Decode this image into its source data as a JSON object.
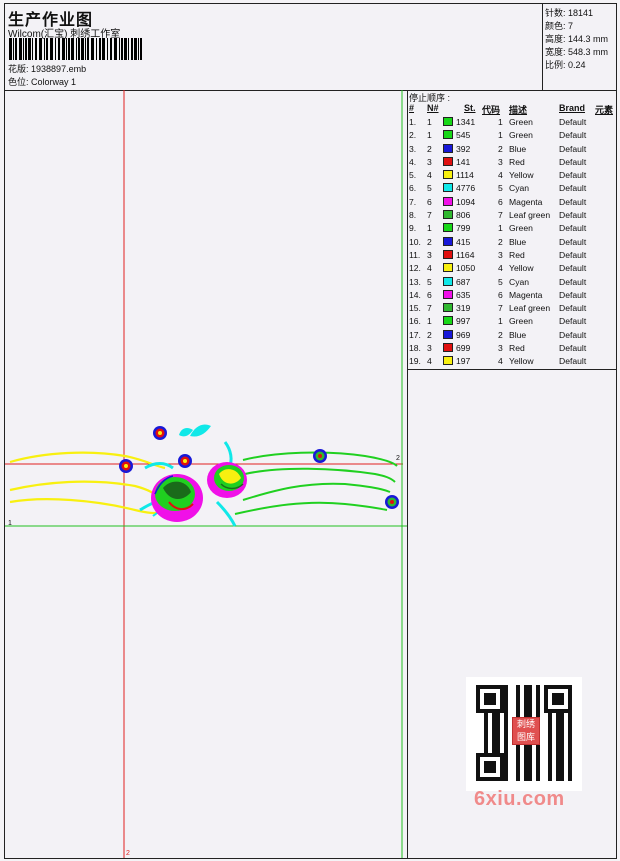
{
  "header": {
    "title": "生产作业图",
    "company": "Wilcom(汇宝) 刺绣工作室",
    "pattern_label": "花版:",
    "pattern_value": "1938897.emb",
    "colorway_label": "色位:",
    "colorway_value": "Colorway 1"
  },
  "specs": [
    {
      "label": "针数:",
      "value": "18141"
    },
    {
      "label": "颜色:",
      "value": "7"
    },
    {
      "label": "高度:",
      "value": "144.3 mm"
    },
    {
      "label": "宽度:",
      "value": "548.3 mm"
    },
    {
      "label": "比例:",
      "value": "0.24"
    }
  ],
  "stop_sequence": {
    "title": "停止顺序 :",
    "columns": [
      "#",
      "N#",
      "St.",
      "代码",
      "描述",
      "Brand",
      "元素"
    ],
    "rows": [
      {
        "idx": "1.",
        "n": "1",
        "st": "1341",
        "code": "1",
        "desc": "Green",
        "brand": "Default",
        "color": "#18d818"
      },
      {
        "idx": "2.",
        "n": "1",
        "st": "545",
        "code": "1",
        "desc": "Green",
        "brand": "Default",
        "color": "#18d818"
      },
      {
        "idx": "3.",
        "n": "2",
        "st": "392",
        "code": "2",
        "desc": "Blue",
        "brand": "Default",
        "color": "#1818d8"
      },
      {
        "idx": "4.",
        "n": "3",
        "st": "141",
        "code": "3",
        "desc": "Red",
        "brand": "Default",
        "color": "#e01010"
      },
      {
        "idx": "5.",
        "n": "4",
        "st": "1114",
        "code": "4",
        "desc": "Yellow",
        "brand": "Default",
        "color": "#f8f010"
      },
      {
        "idx": "6.",
        "n": "5",
        "st": "4776",
        "code": "5",
        "desc": "Cyan",
        "brand": "Default",
        "color": "#10e8e8"
      },
      {
        "idx": "7.",
        "n": "6",
        "st": "1094",
        "code": "6",
        "desc": "Magenta",
        "brand": "Default",
        "color": "#f010e8"
      },
      {
        "idx": "8.",
        "n": "7",
        "st": "806",
        "code": "7",
        "desc": "Leaf green",
        "brand": "Default",
        "color": "#30b830"
      },
      {
        "idx": "9.",
        "n": "1",
        "st": "799",
        "code": "1",
        "desc": "Green",
        "brand": "Default",
        "color": "#18d818"
      },
      {
        "idx": "10.",
        "n": "2",
        "st": "415",
        "code": "2",
        "desc": "Blue",
        "brand": "Default",
        "color": "#1818d8"
      },
      {
        "idx": "11.",
        "n": "3",
        "st": "1164",
        "code": "3",
        "desc": "Red",
        "brand": "Default",
        "color": "#e01010"
      },
      {
        "idx": "12.",
        "n": "4",
        "st": "1050",
        "code": "4",
        "desc": "Yellow",
        "brand": "Default",
        "color": "#f8f010"
      },
      {
        "idx": "13.",
        "n": "5",
        "st": "687",
        "code": "5",
        "desc": "Cyan",
        "brand": "Default",
        "color": "#10e8e8"
      },
      {
        "idx": "14.",
        "n": "6",
        "st": "635",
        "code": "6",
        "desc": "Magenta",
        "brand": "Default",
        "color": "#f010e8"
      },
      {
        "idx": "15.",
        "n": "7",
        "st": "319",
        "code": "7",
        "desc": "Leaf green",
        "brand": "Default",
        "color": "#30b830"
      },
      {
        "idx": "16.",
        "n": "1",
        "st": "997",
        "code": "1",
        "desc": "Green",
        "brand": "Default",
        "color": "#18d818"
      },
      {
        "idx": "17.",
        "n": "2",
        "st": "969",
        "code": "2",
        "desc": "Blue",
        "brand": "Default",
        "color": "#1818d8"
      },
      {
        "idx": "18.",
        "n": "3",
        "st": "699",
        "code": "3",
        "desc": "Red",
        "brand": "Default",
        "color": "#e01010"
      },
      {
        "idx": "19.",
        "n": "4",
        "st": "197",
        "code": "4",
        "desc": "Yellow",
        "brand": "Default",
        "color": "#f8f010"
      }
    ]
  },
  "canvas": {
    "marker_1": "1",
    "marker_2": "2"
  },
  "watermark": {
    "text": "6xiu.com",
    "stamp": "刺绣图库"
  }
}
